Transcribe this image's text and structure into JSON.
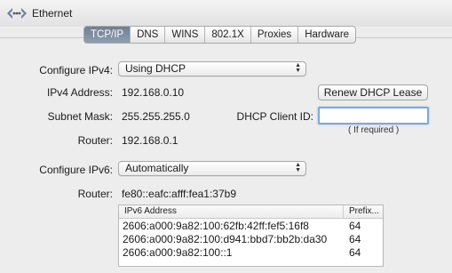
{
  "header": {
    "title": "Ethernet",
    "icon": "ethernet-icon"
  },
  "tabs": [
    "TCP/IP",
    "DNS",
    "WINS",
    "802.1X",
    "Proxies",
    "Hardware"
  ],
  "active_tab": "TCP/IP",
  "ipv4": {
    "configure_label": "Configure IPv4:",
    "configure_value": "Using DHCP",
    "address_label": "IPv4 Address:",
    "address_value": "192.168.0.10",
    "subnet_label": "Subnet Mask:",
    "subnet_value": "255.255.255.0",
    "router_label": "Router:",
    "router_value": "192.168.0.1",
    "renew_button": "Renew DHCP Lease",
    "client_id_label": "DHCP Client ID:",
    "client_id_value": "",
    "client_id_hint": "( If required )"
  },
  "ipv6": {
    "configure_label": "Configure IPv6:",
    "configure_value": "Automatically",
    "router_label": "Router:",
    "router_value": "fe80::eafc:afff:fea1:37b9",
    "table": {
      "headers": [
        "IPv6 Address",
        "Prefix..."
      ],
      "rows": [
        [
          "2606:a000:9a82:100:62fb:42ff:fef5:16f8",
          "64"
        ],
        [
          "2606:a000:9a82:100:d941:bbd7:bb2b:da30",
          "64"
        ],
        [
          "2606:a000:9a82:100::1",
          "64"
        ]
      ]
    }
  },
  "colors": {
    "active_tab": "#7d8ca1",
    "focus_ring": "#7da7d9",
    "panel": "#ededed"
  }
}
